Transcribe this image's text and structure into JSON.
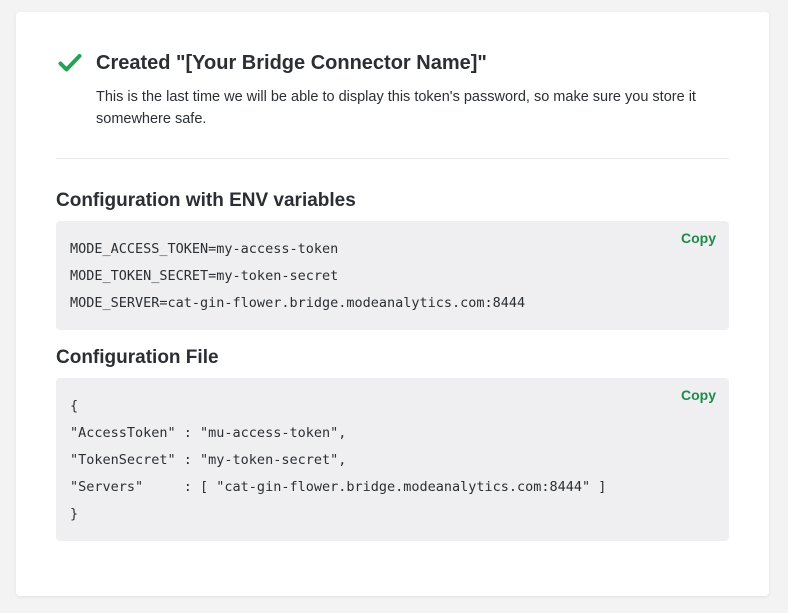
{
  "header": {
    "title": "Created \"[Your Bridge Connector Name]\"",
    "subtitle": "This is the last time we will be able to display this token's password, so make sure you store it somewhere safe."
  },
  "env_section": {
    "title": "Configuration with ENV variables",
    "copy_label": "Copy",
    "lines": [
      "MODE_ACCESS_TOKEN=my-access-token",
      "MODE_TOKEN_SECRET=my-token-secret",
      "MODE_SERVER=cat-gin-flower.bridge.modeanalytics.com:8444"
    ]
  },
  "file_section": {
    "title": "Configuration File",
    "copy_label": "Copy",
    "lines": [
      "{",
      "\"AccessToken\" : \"mu-access-token\",",
      "\"TokenSecret\" : \"my-token-secret\",",
      "\"Servers\"     : [ \"cat-gin-flower.bridge.modeanalytics.com:8444\" ]",
      "}"
    ]
  },
  "colors": {
    "accent_green": "#1f8a4c",
    "check_green": "#23a455",
    "code_bg": "#efeff2",
    "text": "#2b2f33"
  },
  "icons": {
    "success": "checkmark-icon"
  }
}
